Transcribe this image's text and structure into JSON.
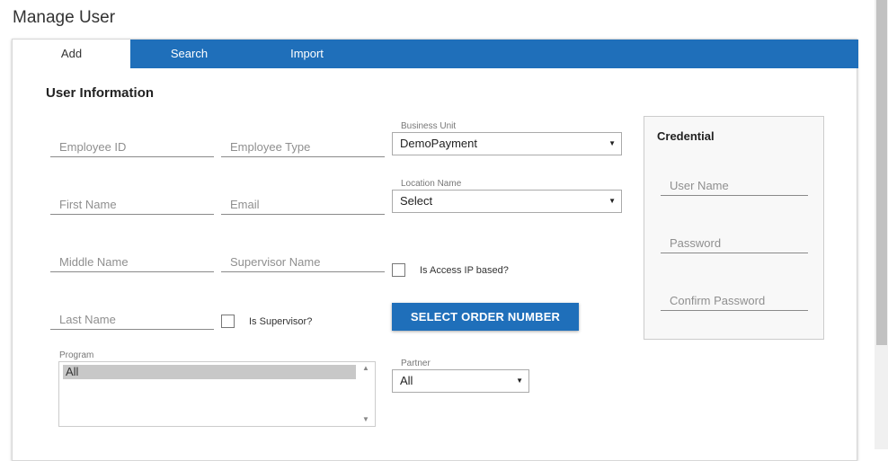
{
  "page": {
    "title": "Manage User"
  },
  "tabs": [
    {
      "label": "Add",
      "active": true
    },
    {
      "label": "Search",
      "active": false
    },
    {
      "label": "Import",
      "active": false
    }
  ],
  "section": {
    "title": "User Information"
  },
  "fields": {
    "employee_id": {
      "placeholder": "Employee ID",
      "value": ""
    },
    "employee_type": {
      "placeholder": "Employee Type",
      "value": ""
    },
    "first_name": {
      "placeholder": "First Name",
      "value": ""
    },
    "email": {
      "placeholder": "Email",
      "value": ""
    },
    "middle_name": {
      "placeholder": "Middle Name",
      "value": ""
    },
    "supervisor_name": {
      "placeholder": "Supervisor Name",
      "value": ""
    },
    "last_name": {
      "placeholder": "Last Name",
      "value": ""
    }
  },
  "business_unit": {
    "label": "Business Unit",
    "selected": "DemoPayment"
  },
  "location_name": {
    "label": "Location Name",
    "selected": "Select"
  },
  "access_ip": {
    "label": "Is Access IP based?",
    "checked": false
  },
  "is_supervisor": {
    "label": "Is Supervisor?",
    "checked": false
  },
  "order_button": {
    "label": "SELECT ORDER NUMBER"
  },
  "program": {
    "label": "Program",
    "options": [
      "All"
    ],
    "selected": "All"
  },
  "partner": {
    "label": "Partner",
    "selected": "All"
  },
  "credential": {
    "title": "Credential",
    "user_name": {
      "placeholder": "User Name",
      "value": ""
    },
    "password": {
      "placeholder": "Password",
      "value": ""
    },
    "confirm_password": {
      "placeholder": "Confirm Password",
      "value": ""
    }
  },
  "colors": {
    "accent": "#1f6fba",
    "tab_text": "#ffffff"
  },
  "icons": {
    "dropdown": "caret-down-icon",
    "scroll_up": "scroll-up-icon",
    "scroll_down": "scroll-down-icon"
  }
}
